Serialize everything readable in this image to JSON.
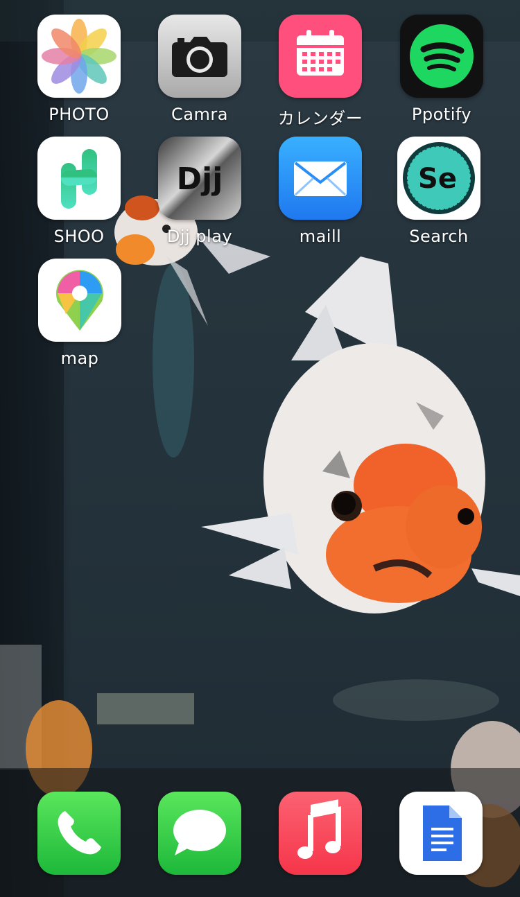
{
  "home_screen": {
    "apps": [
      {
        "label": "PHOTO",
        "icon": "photos-pinwheel-icon"
      },
      {
        "label": "Camra",
        "icon": "camera-icon"
      },
      {
        "label": "カレンダー",
        "icon": "calendar-icon"
      },
      {
        "label": "Ppotify",
        "icon": "spotify-icon"
      },
      {
        "label": "SHOO",
        "icon": "shoo-logo-icon"
      },
      {
        "label": "Djj play",
        "icon": "djj-logo-icon"
      },
      {
        "label": "maill",
        "icon": "mail-envelope-icon"
      },
      {
        "label": "Search",
        "icon": "search-se-logo-icon"
      },
      {
        "label": "map",
        "icon": "map-pin-icon"
      }
    ],
    "djj_logo_text": "Djj",
    "search_logo_text": "Se"
  },
  "dock": {
    "apps": [
      {
        "icon": "phone-icon"
      },
      {
        "icon": "messages-bubble-icon"
      },
      {
        "icon": "music-note-icon"
      },
      {
        "icon": "document-icon"
      }
    ]
  },
  "colors": {
    "calendar": "#ff4f7d",
    "spotify_green": "#1ed760",
    "mail_blue": "#2a8ef7",
    "phone_green": "#28c840",
    "music_red": "#fb3d4e",
    "docs_blue": "#2d6ee6"
  },
  "wallpaper": "goldfish-aquarium-photo"
}
